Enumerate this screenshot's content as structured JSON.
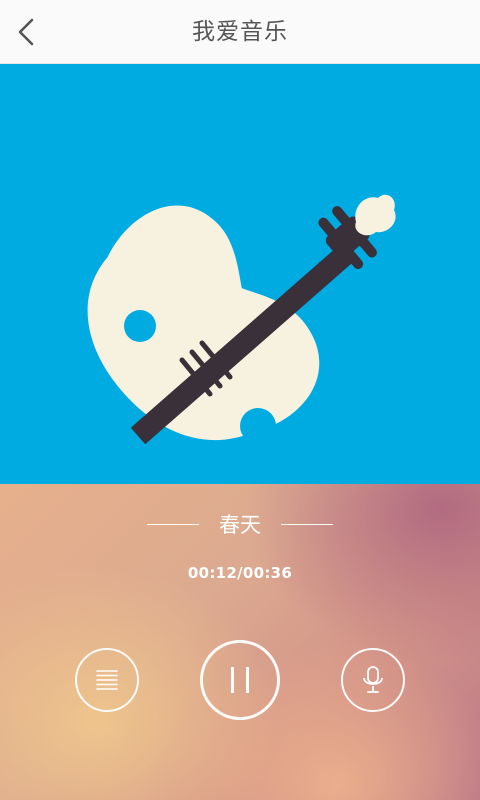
{
  "header": {
    "title": "我爱音乐",
    "back_icon": "chevron-left-icon"
  },
  "artwork": {
    "background": "#00abe2",
    "icon": "violin-icon",
    "body_color": "#f7f2df",
    "neck_color": "#3a3039"
  },
  "player": {
    "song_title": "春天",
    "time_display": "00:12/00:36",
    "progress": 0.333,
    "controls": {
      "playlist_icon": "playlist-icon",
      "pause_icon": "pause-icon",
      "mic_icon": "microphone-icon"
    }
  }
}
